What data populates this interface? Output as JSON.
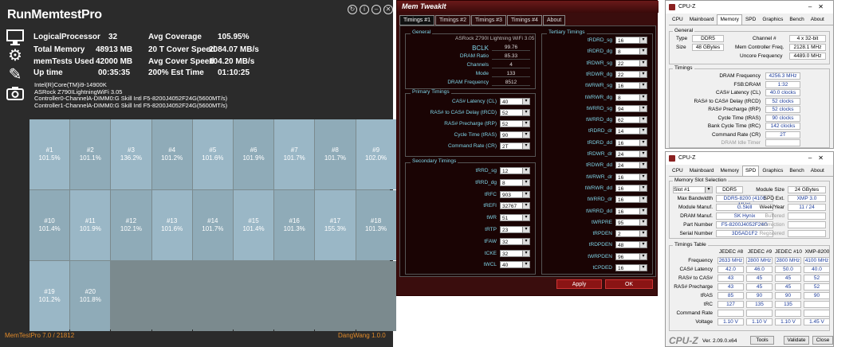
{
  "rmt": {
    "title": "RunMemtestPro",
    "win_buttons": [
      "↻",
      "i",
      "–",
      "✕"
    ],
    "stats_left": [
      {
        "label": "LogicalProcessor",
        "value": "32"
      },
      {
        "label": "Total Memory",
        "value": "48913 MB"
      },
      {
        "label": "memTests Used",
        "value": "42000 MB"
      },
      {
        "label": "Up time",
        "value": "00:35:35"
      }
    ],
    "stats_right": [
      {
        "label": "Avg Coverage",
        "value": "105.95%"
      },
      {
        "label": "20 T Cover Speed",
        "value": "2084.07 MB/s"
      },
      {
        "label": "Avg Cover Speed",
        "value": "104.20 MB/s"
      },
      {
        "label": "200% Est Time",
        "value": "01:10:25"
      }
    ],
    "sysinfo": [
      "Intel(R)Core(TM)i9-14900K",
      "ASRock Z790ILightningWiFi 3.05",
      "Controller0-ChannelA-DIMM0:G Skill Intl F5-8200J4052F24G(5600MT/s)",
      "Controller1-ChannelA-DIMM0:G Skill Intl F5-8200J4052F24G(5600MT/s)"
    ],
    "cells": [
      {
        "id": "#1",
        "pct": "101.5%"
      },
      {
        "id": "#2",
        "pct": "101.1%"
      },
      {
        "id": "#3",
        "pct": "136.2%"
      },
      {
        "id": "#4",
        "pct": "101.2%"
      },
      {
        "id": "#5",
        "pct": "101.6%"
      },
      {
        "id": "#6",
        "pct": "101.9%"
      },
      {
        "id": "#7",
        "pct": "101.7%"
      },
      {
        "id": "#8",
        "pct": "101.7%"
      },
      {
        "id": "#9",
        "pct": "102.0%"
      },
      {
        "id": "#10",
        "pct": "101.4%"
      },
      {
        "id": "#11",
        "pct": "101.9%"
      },
      {
        "id": "#12",
        "pct": "102.1%"
      },
      {
        "id": "#13",
        "pct": "101.6%"
      },
      {
        "id": "#14",
        "pct": "101.7%"
      },
      {
        "id": "#15",
        "pct": "101.4%"
      },
      {
        "id": "#16",
        "pct": "101.3%"
      },
      {
        "id": "#17",
        "pct": "155.3%"
      },
      {
        "id": "#18",
        "pct": "101.3%"
      },
      {
        "id": "#19",
        "pct": "101.2%"
      },
      {
        "id": "#20",
        "pct": "101.8%"
      }
    ],
    "footer_left": "MemTestPro 7.0 / 21812",
    "footer_right": "DangWang 1.0.0"
  },
  "mt": {
    "title": "Mem TweakIt",
    "tabs": [
      "Timings #1",
      "Timings #2",
      "Timings #3",
      "Timings #4",
      "About"
    ],
    "general": {
      "title": "General",
      "board": "ASRock Z790I Lightning WiFi 3.05",
      "rows": [
        {
          "label": "BCLK",
          "value": "99.76"
        },
        {
          "label": "DRAM Ratio",
          "value": "85.33"
        },
        {
          "label": "Channels",
          "value": "4"
        },
        {
          "label": "Mode",
          "value": "133"
        },
        {
          "label": "DRAM Frequency",
          "value": "8512"
        }
      ]
    },
    "primary": {
      "title": "Primary Timings",
      "rows": [
        {
          "label": "CAS# Latency (CL)",
          "value": "40"
        },
        {
          "label": "RAS# to CAS# Delay (tRCD)",
          "value": "52"
        },
        {
          "label": "RAS# Precharge (tRP)",
          "value": "52"
        },
        {
          "label": "Cycle Time (tRAS)",
          "value": "90"
        },
        {
          "label": "Command Rate (CR)",
          "value": "2T"
        }
      ]
    },
    "secondary": {
      "title": "Secondary Timings",
      "rows": [
        {
          "label": "tRRD_sg",
          "value": "12"
        },
        {
          "label": "tRRD_dg",
          "value": "8"
        },
        {
          "label": "tRFC",
          "value": "903"
        },
        {
          "label": "tREFI",
          "value": "32767"
        },
        {
          "label": "tWR",
          "value": "51"
        },
        {
          "label": "tRTP",
          "value": "23"
        },
        {
          "label": "tFAW",
          "value": "32"
        },
        {
          "label": "tCKE",
          "value": "32"
        },
        {
          "label": "tWCL",
          "value": "40"
        }
      ]
    },
    "tertiary": {
      "title": "Tertiary Timings",
      "rows": [
        {
          "label": "tRDRD_sg",
          "value": "16"
        },
        {
          "label": "tRDRD_dg",
          "value": "8"
        },
        {
          "label": "tRDWR_sg",
          "value": "22"
        },
        {
          "label": "tRDWR_dg",
          "value": "22"
        },
        {
          "label": "tWRWR_sg",
          "value": "16"
        },
        {
          "label": "tWRWR_dg",
          "value": "8"
        },
        {
          "label": "tWRRD_sg",
          "value": "94"
        },
        {
          "label": "tWRRD_dg",
          "value": "62"
        },
        {
          "label": "tRDRD_dr",
          "value": "14"
        },
        {
          "label": "tRDRD_dd",
          "value": "16"
        },
        {
          "label": "tRDWR_dr",
          "value": "24"
        },
        {
          "label": "tRDWR_dd",
          "value": "24"
        },
        {
          "label": "tWRWR_dr",
          "value": "16"
        },
        {
          "label": "tWRWR_dd",
          "value": "16"
        },
        {
          "label": "tWRRD_dr",
          "value": "16"
        },
        {
          "label": "tWRRD_dd",
          "value": "16"
        },
        {
          "label": "tWRPRE",
          "value": "95"
        },
        {
          "label": "tRPDEN",
          "value": "2"
        },
        {
          "label": "tRDPDEN",
          "value": "48"
        },
        {
          "label": "tWRPDEN",
          "value": "96"
        },
        {
          "label": "tCPDED",
          "value": "16"
        }
      ]
    },
    "apply": "Apply",
    "ok": "OK"
  },
  "cz1": {
    "title": "CPU-Z",
    "tabs": [
      "CPU",
      "Mainboard",
      "Memory",
      "SPD",
      "Graphics",
      "Bench",
      "About"
    ],
    "general_title": "General",
    "type_label": "Type",
    "type": "DDR5",
    "size_label": "Size",
    "size": "48 GBytes",
    "channel_label": "Channel #",
    "channel": "4 x 32-bit",
    "mcf_label": "Mem Controller Freq.",
    "mcf": "2128.1 MHz",
    "uncore_label": "Uncore Frequency",
    "uncore": "4489.0 MHz",
    "timings_title": "Timings",
    "rows": [
      {
        "label": "DRAM Frequency",
        "value": "4256.3 MHz"
      },
      {
        "label": "FSB:DRAM",
        "value": "1:32"
      },
      {
        "label": "CAS# Latency (CL)",
        "value": "40.0 clocks"
      },
      {
        "label": "RAS# to CAS# Delay (tRCD)",
        "value": "52 clocks"
      },
      {
        "label": "RAS# Precharge (tRP)",
        "value": "52 clocks"
      },
      {
        "label": "Cycle Time (tRAS)",
        "value": "90 clocks"
      },
      {
        "label": "Bank Cycle Time (tRC)",
        "value": "142 clocks"
      },
      {
        "label": "Command Rate (CR)",
        "value": "2T"
      },
      {
        "label": "DRAM Idle Timer",
        "value": ""
      }
    ]
  },
  "cz2": {
    "title": "CPU-Z",
    "tabs": [
      "CPU",
      "Mainboard",
      "Memory",
      "SPD",
      "Graphics",
      "Bench",
      "About"
    ],
    "slot_title": "Memory Slot Selection",
    "slot": "Slot #1",
    "type": "DDR5",
    "module_size_label": "Module Size",
    "module_size": "24 GBytes",
    "left_rows": [
      {
        "label": "Max Bandwidth",
        "value": "DDR5-8200 (4100 MHz)"
      },
      {
        "label": "Module Manuf.",
        "value": "G.Skill"
      },
      {
        "label": "DRAM Manuf.",
        "value": "SK Hynix"
      },
      {
        "label": "Part Number",
        "value": "F5-8200J4052F24G"
      },
      {
        "label": "Serial Number",
        "value": "3D5AD1F2"
      }
    ],
    "right_rows": [
      {
        "label": "SPD Ext.",
        "value": "XMP 3.0"
      },
      {
        "label": "Week/Year",
        "value": "11 / 24"
      },
      {
        "label": "Buffered",
        "value": ""
      },
      {
        "label": "Correction",
        "value": ""
      },
      {
        "label": "Registered",
        "value": ""
      }
    ],
    "table_title": "Timings Table",
    "cols": [
      "JEDEC #8",
      "JEDEC #9",
      "JEDEC #10",
      "XMP-8200"
    ],
    "trows": [
      {
        "label": "Frequency",
        "v": [
          "2633 MHz",
          "2800 MHz",
          "2800 MHz",
          "4100 MHz"
        ]
      },
      {
        "label": "CAS# Latency",
        "v": [
          "42.0",
          "46.0",
          "50.0",
          "40.0"
        ]
      },
      {
        "label": "RAS# to CAS#",
        "v": [
          "43",
          "45",
          "45",
          "52"
        ]
      },
      {
        "label": "RAS# Precharge",
        "v": [
          "43",
          "45",
          "45",
          "52"
        ]
      },
      {
        "label": "tRAS",
        "v": [
          "85",
          "90",
          "90",
          "90"
        ]
      },
      {
        "label": "tRC",
        "v": [
          "127",
          "135",
          "135",
          ""
        ]
      },
      {
        "label": "Command Rate",
        "v": [
          "",
          "",
          "",
          ""
        ]
      },
      {
        "label": "Voltage",
        "v": [
          "1.10 V",
          "1.10 V",
          "1.10 V",
          "1.45 V"
        ]
      }
    ],
    "brand": "CPU-Z",
    "version": "Ver. 2.09.0.x64",
    "tools": "Tools",
    "validate": "Validate",
    "close": "Close"
  }
}
